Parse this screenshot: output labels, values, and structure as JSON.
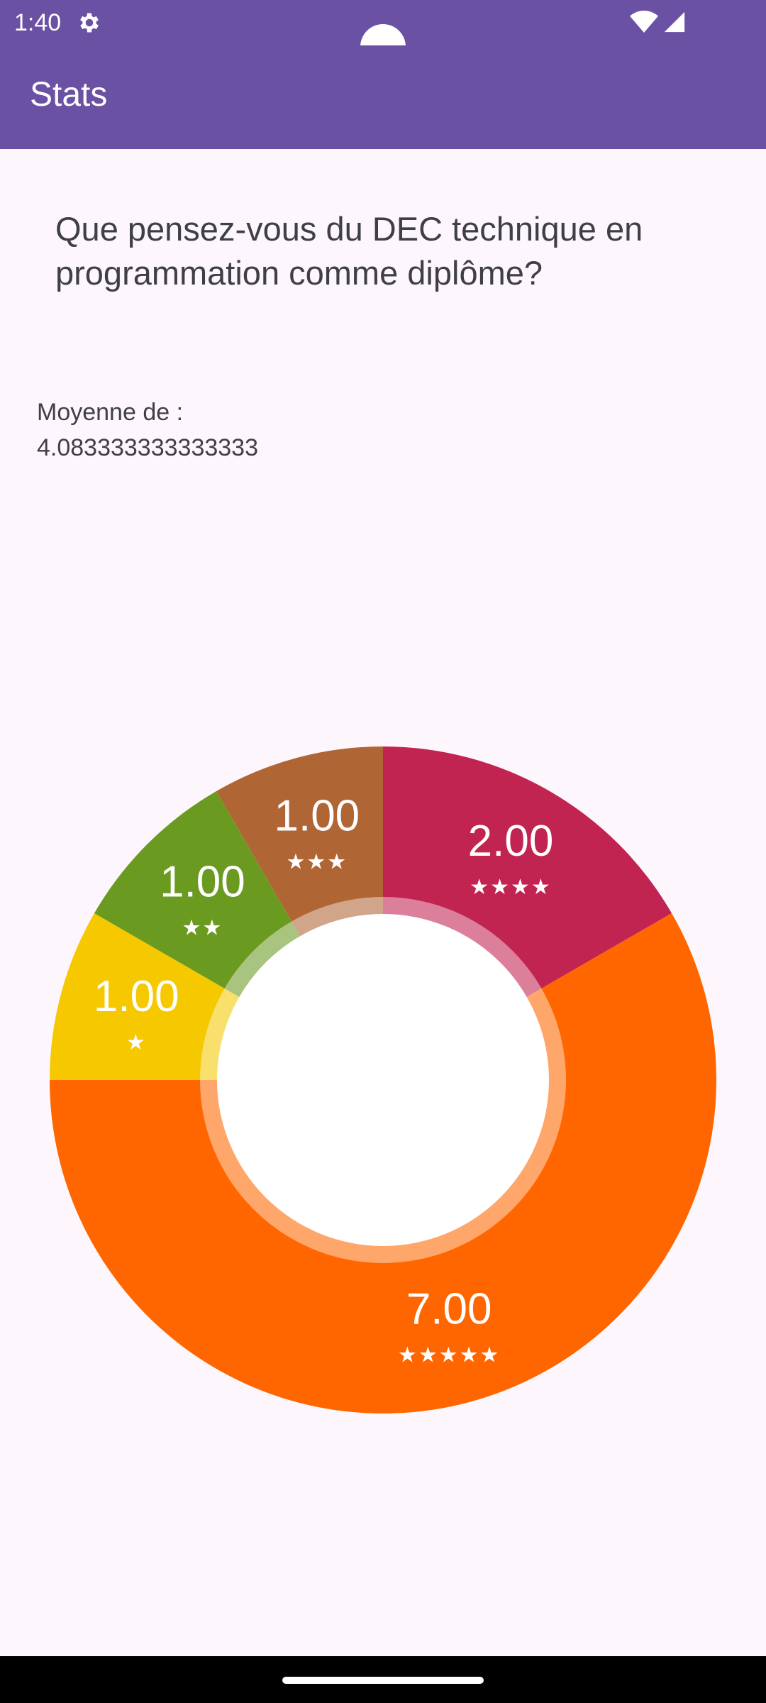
{
  "status_bar": {
    "time": "1:40",
    "icons": [
      "gear-icon",
      "wifi-icon",
      "cell-signal-icon"
    ],
    "background_color": "#6a51a3"
  },
  "app_bar": {
    "title": "Stats",
    "background_color": "#6a51a3"
  },
  "question": "Que pensez-vous du DEC technique en programmation comme diplôme?",
  "average": {
    "label": "Moyenne de :",
    "value": "4.083333333333333"
  },
  "chart_data": {
    "type": "pie",
    "slices": [
      {
        "value": 2,
        "display": "2.00",
        "stars": "★★★★",
        "color": "#c22452"
      },
      {
        "value": 7,
        "display": "7.00",
        "stars": "★★★★★",
        "color": "#ff6600"
      },
      {
        "value": 1,
        "display": "1.00",
        "stars": "★",
        "color": "#f5c800"
      },
      {
        "value": 1,
        "display": "1.00",
        "stars": "★★",
        "color": "#6b9a21"
      },
      {
        "value": 1,
        "display": "1.00",
        "stars": "★★★",
        "color": "#b06534"
      }
    ],
    "hole_color": "#ffffff"
  }
}
